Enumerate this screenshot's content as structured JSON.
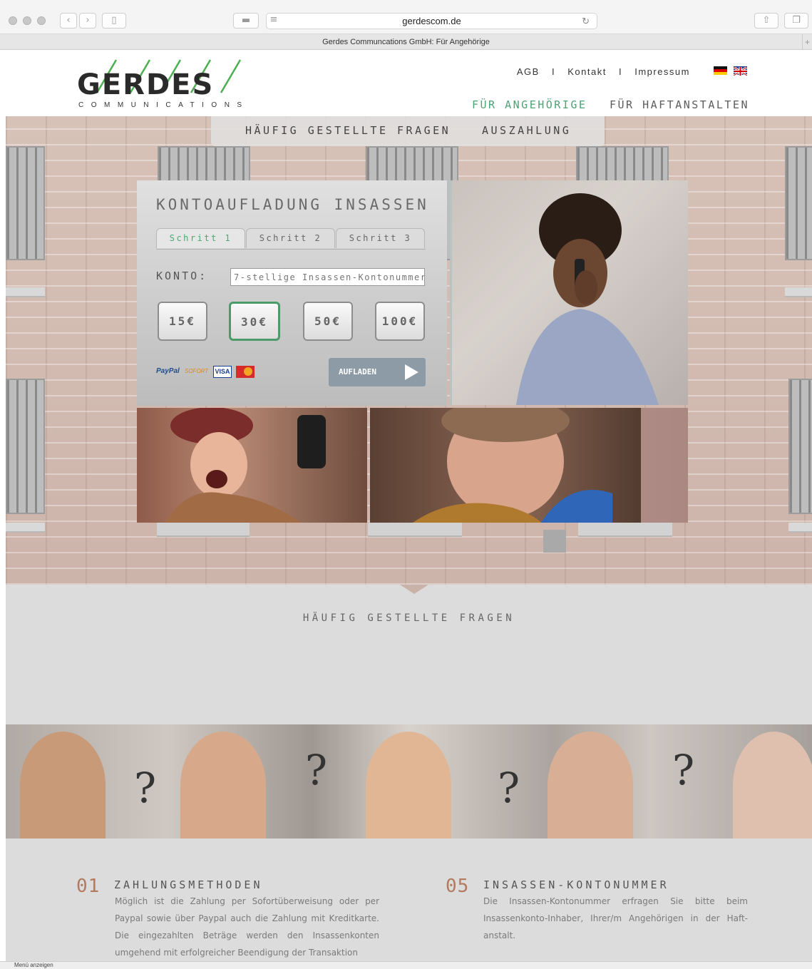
{
  "browser": {
    "url": "gerdescom.de",
    "tab_title": "Gerdes Communcations GmbH: Für Angehörige",
    "new_tab": "+",
    "status": "Menü anzeigen"
  },
  "header": {
    "logo_word": "GERDES",
    "logo_sub": "COMMUNICATIONS",
    "links": [
      "AGB",
      "Kontakt",
      "Impressum"
    ],
    "separator": "I",
    "nav": [
      "FÜR ANGEHÖRIGE",
      "FÜR HAFTANSTALTEN"
    ]
  },
  "subnav": [
    "HÄUFIG GESTELLTE FRAGEN",
    "AUSZAHLUNG"
  ],
  "panel": {
    "title": "KONTOAUFLADUNG INSASSEN",
    "steps": [
      "Schritt 1",
      "Schritt 2",
      "Schritt 3"
    ],
    "konto_label": "KONTO:",
    "konto_placeholder": "7-stellige Insassen-Kontonummer",
    "amounts": [
      "15€",
      "30€",
      "50€",
      "100€"
    ],
    "selected_amount": "30€",
    "payment": {
      "paypal": "PayPal",
      "sofort": "SOFORT",
      "visa": "VISA"
    },
    "submit_label": "AUFLADEN"
  },
  "faq": {
    "heading": "HÄUFIG GESTELLTE FRAGEN",
    "items": [
      {
        "num": "01",
        "title": "ZAHLUNGSMETHODEN",
        "text": "Möglich ist die Zahlung per Sofortüberweisung oder per Paypal sowie über Paypal auch die Zahlung mit Kreditkarte. Die eingezahlten Beträge werden den Insassenkonten umgehend mit erfolgreicher Beendigung der Transaktion"
      },
      {
        "num": "05",
        "title": "INSASSEN-KONTONUMMER",
        "text": "Die Insassen-Kontonummer erfragen Sie bitte beim Insassenkonto-Inhaber, Ihrer/m Angehörigen in der Haft-anstalt."
      }
    ]
  },
  "colors": {
    "accent_green": "#4ca373",
    "number_brown": "#b27a5f"
  }
}
